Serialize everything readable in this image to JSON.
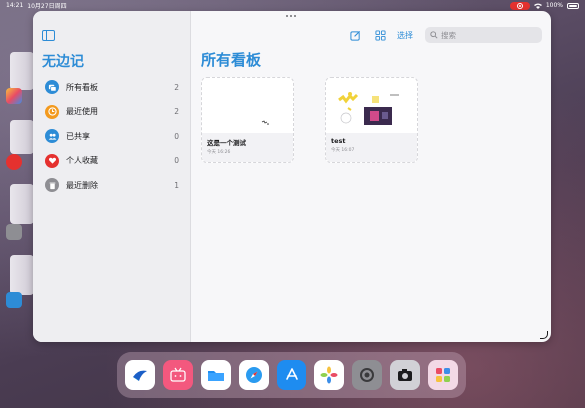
{
  "status_bar": {
    "time": "14:21",
    "date": "10月27日周四",
    "battery": "100%"
  },
  "app": {
    "title": "无边记",
    "sidebar": {
      "items": [
        {
          "label": "所有看板",
          "count": "2",
          "icon": "boards-icon",
          "color": "#2d8cd6"
        },
        {
          "label": "最近使用",
          "count": "2",
          "icon": "clock-icon",
          "color": "#f39a1e"
        },
        {
          "label": "已共享",
          "count": "0",
          "icon": "people-icon",
          "color": "#2d8cd6"
        },
        {
          "label": "个人收藏",
          "count": "0",
          "icon": "heart-icon",
          "color": "#e5312f"
        },
        {
          "label": "最近删除",
          "count": "1",
          "icon": "trash-icon",
          "color": "#8e8e93"
        }
      ]
    },
    "toolbar": {
      "select_label": "选择",
      "search_placeholder": "搜索"
    },
    "main": {
      "title": "所有看板",
      "boards": [
        {
          "name": "这是一个测试",
          "date": "今天 16:26"
        },
        {
          "name": "test",
          "date": "今天 16:07"
        }
      ]
    }
  },
  "dock": {
    "apps": [
      "lark-icon",
      "bilibili-icon",
      "files-icon",
      "safari-icon",
      "app-store-icon",
      "photos-icon",
      "settings-icon",
      "camera-icon",
      "app-library-icon"
    ]
  },
  "colors": {
    "accent": "#2d8cd6",
    "recording": "#e5312f"
  }
}
